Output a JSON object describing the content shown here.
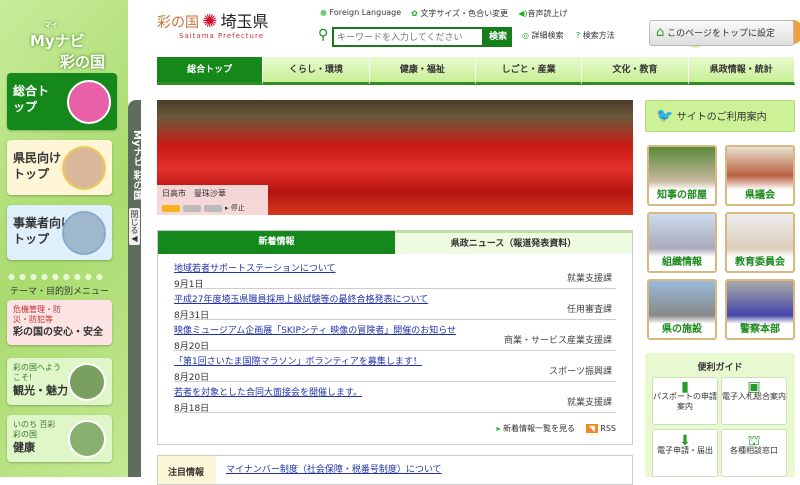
{
  "sidebar": {
    "logo_ruby": "マイ",
    "logo_line1": "Myナビ",
    "logo_line2": "彩の国",
    "top": "総合トップ",
    "residents": "県民向けトップ",
    "business": "事業者向けトップ",
    "theme_label": "テーマ・目的別メニュー",
    "themes": [
      {
        "sub": "危機管理・防災・防犯等",
        "title": "彩の国の安心・安全"
      },
      {
        "sub": "彩の国へようこそ!",
        "title": "観光・魅力"
      },
      {
        "sub": "いのち 百彩 彩の国",
        "title": "健康"
      }
    ],
    "strip_label": "Myナビ 彩の国",
    "close": "閉じる◀"
  },
  "header": {
    "logo_left": "彩の国",
    "logo_right": "埼玉県",
    "logo_en": "Saitama Prefecture",
    "links": [
      "Foreign Language",
      "文字サイズ・色合い変更",
      "音声読上げ"
    ],
    "search_placeholder": "キーワードを入力してください",
    "search_button": "検索",
    "advanced": "詳細検索",
    "howto": "検索方法",
    "set_top": "このページをトップに設定"
  },
  "nav": [
    "総合トップ",
    "くらし・環境",
    "健康・福祉",
    "しごと・産業",
    "文化・教育",
    "県政情報・統計"
  ],
  "hero": {
    "caption": "日高市　曼珠沙華",
    "stop": "▸ 停止"
  },
  "news": {
    "tabs": [
      "新着情報",
      "県政ニュース（報道発表資料）"
    ],
    "items": [
      {
        "title": "地域若者サポートステーションについて",
        "date": "9月1日",
        "dept": "就業支援課"
      },
      {
        "title": "平成27年度埼玉県職員採用上級試験等の最終合格発表について",
        "date": "8月31日",
        "dept": "任用審査課"
      },
      {
        "title": "映像ミュージアム企画展「SKIPシティ 映像の冒険者」開催のお知らせ",
        "date": "8月20日",
        "dept": "商業・サービス産業支援課"
      },
      {
        "title": "「第1回さいたま国際マラソン」ボランティアを募集します！",
        "date": "8月20日",
        "dept": "スポーツ振興課"
      },
      {
        "title": "若者を対象とした合同大面接会を開催します。",
        "date": "8月18日",
        "dept": "就業支援課"
      }
    ],
    "more": "新着情報一覧を見る",
    "rss": "RSS"
  },
  "attention": {
    "label": "注目情報",
    "link": "マイナンバー制度（社会保障・税番号制度）について"
  },
  "right": {
    "guide_btn": "サイトのご利用案内",
    "tiles": [
      "知事の部屋",
      "県議会",
      "組織情報",
      "教育委員会",
      "県の施設",
      "警察本部"
    ],
    "guide_title": "便利ガイド",
    "guides": [
      "パスポートの申請案内",
      "電子入札総合案内",
      "電子申請・届出",
      "各種相談窓口"
    ]
  }
}
